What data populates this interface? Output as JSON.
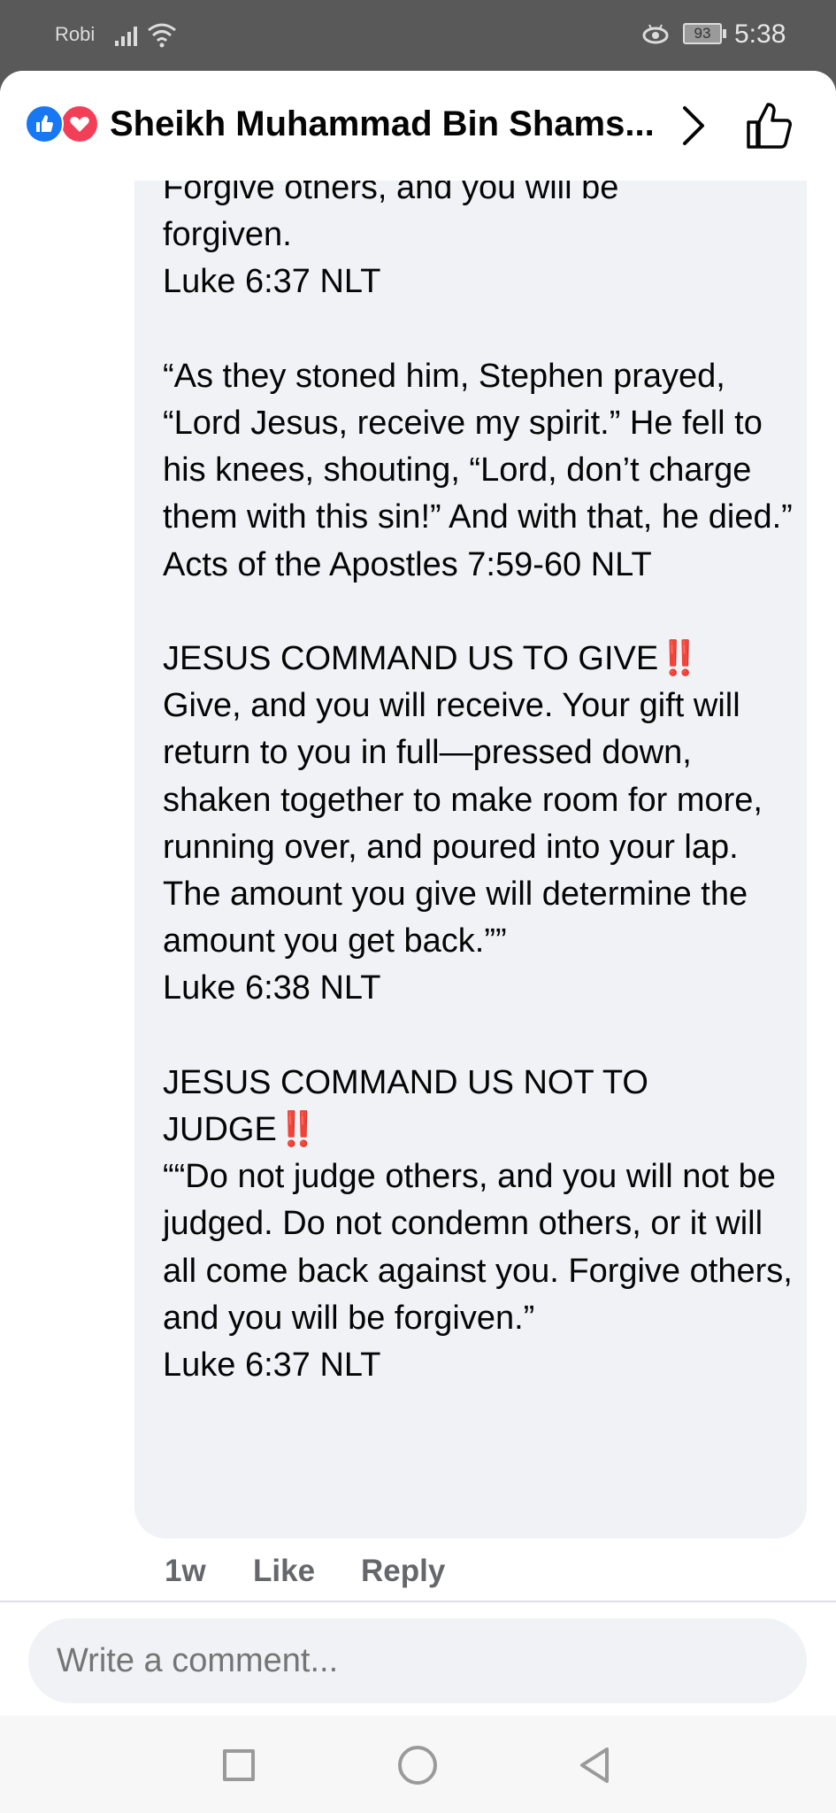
{
  "status_bar": {
    "carrier": "Robi",
    "battery": "93",
    "time": "5:38"
  },
  "header": {
    "title": "Sheikh Muhammad Bin Shams..."
  },
  "comment": {
    "text": "Forgive others, and you will be\nforgiven.\nLuke 6:37 NLT\n\n“As they stoned him, Stephen prayed, “Lord Jesus, receive my spirit.” He fell to his knees, shouting, “Lord, don’t charge them with this sin!” And with that, he died.”\nActs of the Apostles 7:59-60 NLT\n\nJESUS COMMAND US TO GIVE‼️\nGive, and you will receive. Your gift will return to you in full—pressed down, shaken together to make room for more, running over, and poured into your lap. The amount you give will determine the amount you get back.””\nLuke 6:38 NLT\n\nJESUS COMMAND US NOT TO JUDGE‼️\n““Do not judge others, and you will not be judged. Do not condemn others, or it will all come back against you. Forgive others, and you will be forgiven.”\nLuke 6:37 NLT",
    "time_ago": "1w",
    "like_label": "Like",
    "reply_label": "Reply"
  },
  "composer": {
    "placeholder": "Write a comment..."
  },
  "colors": {
    "like_blue": "#1877f2",
    "love_red": "#f33e58",
    "bubble_bg": "#f0f2f5"
  },
  "icons": {
    "reactions": [
      "like-reaction-icon",
      "love-reaction-icon"
    ],
    "header_actions": [
      "chevron-right-icon",
      "thumbs-up-icon"
    ],
    "nav": [
      "recent-apps-icon",
      "home-icon",
      "back-icon"
    ]
  }
}
